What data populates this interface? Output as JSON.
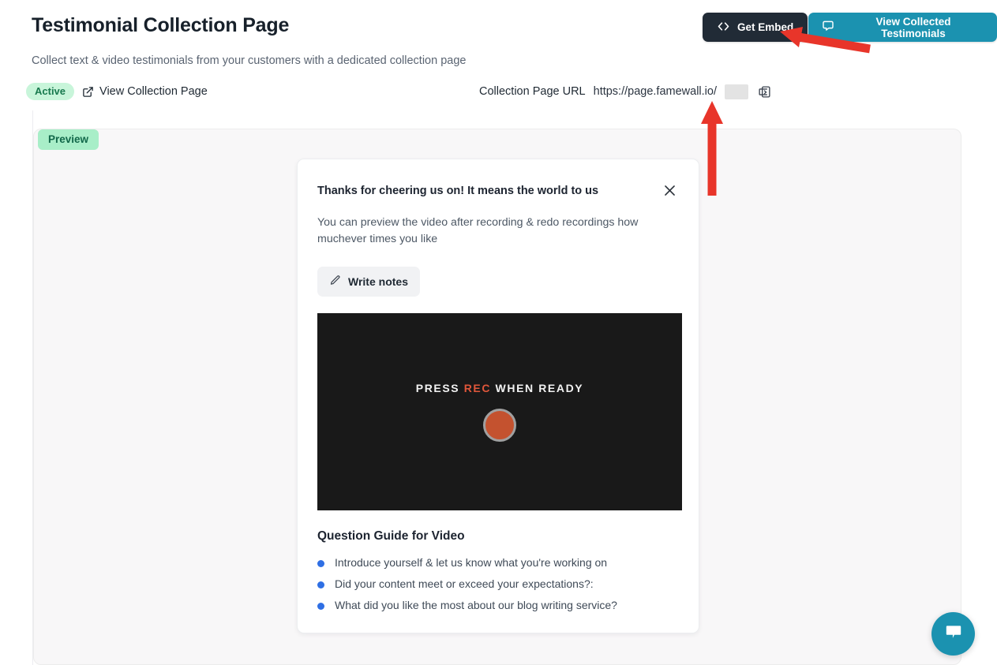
{
  "header": {
    "title": "Testimonial Collection Page",
    "subtitle": "Collect text & video testimonials from your customers with a dedicated collection page",
    "status_badge": "Active",
    "view_collection_link": "View Collection Page",
    "get_embed_button": "Get Embed",
    "view_testimonials_button": "View Collected Testimonials"
  },
  "url_section": {
    "label": "Collection Page URL",
    "value": "https://page.famewall.io/",
    "redacted_slug": "",
    "copy_icon": "clipboard-copy-icon"
  },
  "preview": {
    "badge": "Preview"
  },
  "card": {
    "title": "Thanks for cheering us on! It means the world to us",
    "description": "You can preview the video after recording & redo recordings how muchever times you like",
    "write_notes_button": "Write notes",
    "close_icon": "close-icon",
    "video": {
      "prompt_prefix": "PRESS ",
      "prompt_rec": "REC",
      "prompt_suffix": " WHEN READY",
      "record_button": "record-button"
    },
    "question_guide": {
      "title": "Question Guide for Video",
      "questions": [
        "Introduce yourself & let us know what you're working on",
        "Did your content meet or exceed your expectations?:",
        "What did you like the most about our blog writing service?"
      ]
    }
  },
  "chat": {
    "icon": "chat-bubble-icon"
  },
  "annotations": {
    "arrow_color": "#e8352a",
    "arrow_1_target": "get-embed-button",
    "arrow_2_target": "collection-page-url"
  },
  "colors": {
    "dark_button": "#212b36",
    "teal_accent": "#1b92b0",
    "active_badge_bg": "#c8f5da",
    "preview_badge_bg": "#a8eec8",
    "bullet_blue": "#2f6fe4",
    "record_red": "#c4522f"
  }
}
